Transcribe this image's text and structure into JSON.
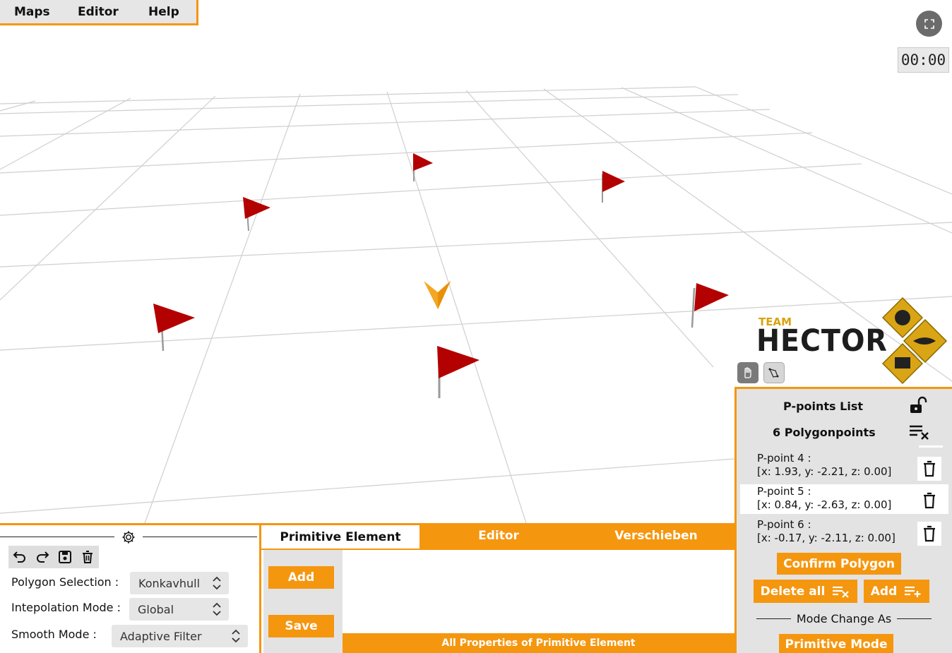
{
  "menu": {
    "items": [
      "Maps",
      "Editor",
      "Help"
    ]
  },
  "timer": "00:00",
  "logo": {
    "team": "TEAM",
    "name": "HECTOR"
  },
  "left_panel": {
    "polygon_selection": {
      "label": "Polygon Selection :",
      "value": "Konkavhull"
    },
    "interpolation_mode": {
      "label": "Intepolation Mode :",
      "value": "Global"
    },
    "smooth_mode": {
      "label": "Smooth Mode :",
      "value": "Adaptive Filter"
    }
  },
  "center_panel": {
    "tabs": [
      "Primitive Element",
      "Editor",
      "Verschieben"
    ],
    "add_label": "Add",
    "save_label": "Save",
    "properties_label": "All Properties of Primitive Element"
  },
  "right_panel": {
    "list_title": "P-points List",
    "count_label": "6 Polygonpoints",
    "points": [
      {
        "name": "P-point 4 :",
        "coords": "[x: 1.93, y: -2.21, z: 0.00]"
      },
      {
        "name": "P-point 5 :",
        "coords": "[x: 0.84, y: -2.63, z: 0.00]"
      },
      {
        "name": "P-point 6 :",
        "coords": "[x: -0.17, y: -2.11, z: 0.00]"
      }
    ],
    "confirm_label": "Confirm Polygon",
    "delete_all_label": "Delete all",
    "add_label": "Add",
    "mode_change_label": "Mode Change As",
    "mode_button_label": "Primitive Mode"
  },
  "colors": {
    "accent": "#f5960f",
    "flag": "#b30000",
    "grid": "#c8c8c8",
    "panel": "#e3e3e3"
  },
  "icons": [
    "fullscreen-icon",
    "hand-icon",
    "polygon-tool-icon",
    "gear-icon",
    "undo-icon",
    "redo-icon",
    "save-icon",
    "trash-icon",
    "unlock-icon",
    "clear-list-icon",
    "add-list-icon",
    "chevron-updown-icon",
    "flag-icon",
    "robot-marker-icon"
  ]
}
